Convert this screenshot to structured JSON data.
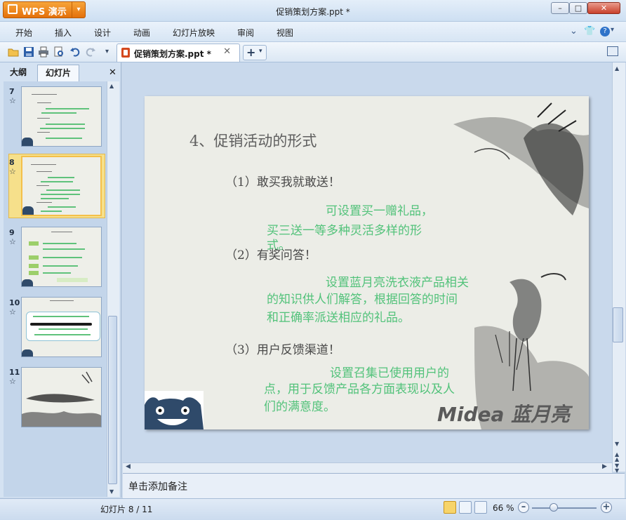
{
  "app": {
    "brand": "WPS 演示",
    "window_title": "促销策划方案.ppt *"
  },
  "menu": [
    "开始",
    "插入",
    "设计",
    "动画",
    "幻灯片放映",
    "审阅",
    "视图"
  ],
  "toolbar": {
    "doc_tab_label": "促销策划方案.ppt *",
    "doc_tab_close": "✕",
    "new_tab_plus": "+"
  },
  "left_panel": {
    "tabs": [
      "大纲",
      "幻灯片"
    ],
    "close": "✕",
    "slides": [
      {
        "number": "7",
        "star": "☆"
      },
      {
        "number": "8",
        "star": "☆"
      },
      {
        "number": "9",
        "star": "☆"
      },
      {
        "number": "10",
        "star": "☆"
      },
      {
        "number": "11",
        "star": "☆"
      }
    ],
    "selected_slide": 8
  },
  "slide": {
    "title": "4、促销活动的形式",
    "items": [
      {
        "heading": "（1）敢买我就敢送！",
        "lines": [
          "可设置买一赠礼品，",
          "买三送一等多种灵活多样的形",
          "式。"
        ]
      },
      {
        "heading": "（2）有奖问答！",
        "lines": [
          "设置蓝月亮洗衣液产品相关",
          "的知识供人们解答，根据回答的时间",
          "和正确率派送相应的礼品。"
        ]
      },
      {
        "heading": "（3）用户反馈渠道！",
        "lines": [
          "设置召集已使用用户的",
          "点，用于反馈产品各方面表现以及人",
          "们的满意度。"
        ]
      }
    ],
    "logo": "Midea 蓝月亮"
  },
  "notes": {
    "placeholder": "单击添加备注"
  },
  "status": {
    "slide_counter": "幻灯片 8 / 11",
    "zoom": "66 %",
    "zoom_level_percent": 66
  },
  "colors": {
    "accent_orange": "#e4700a",
    "slide_green_text": "#52c27a",
    "selection_yellow": "#f6e08b"
  }
}
